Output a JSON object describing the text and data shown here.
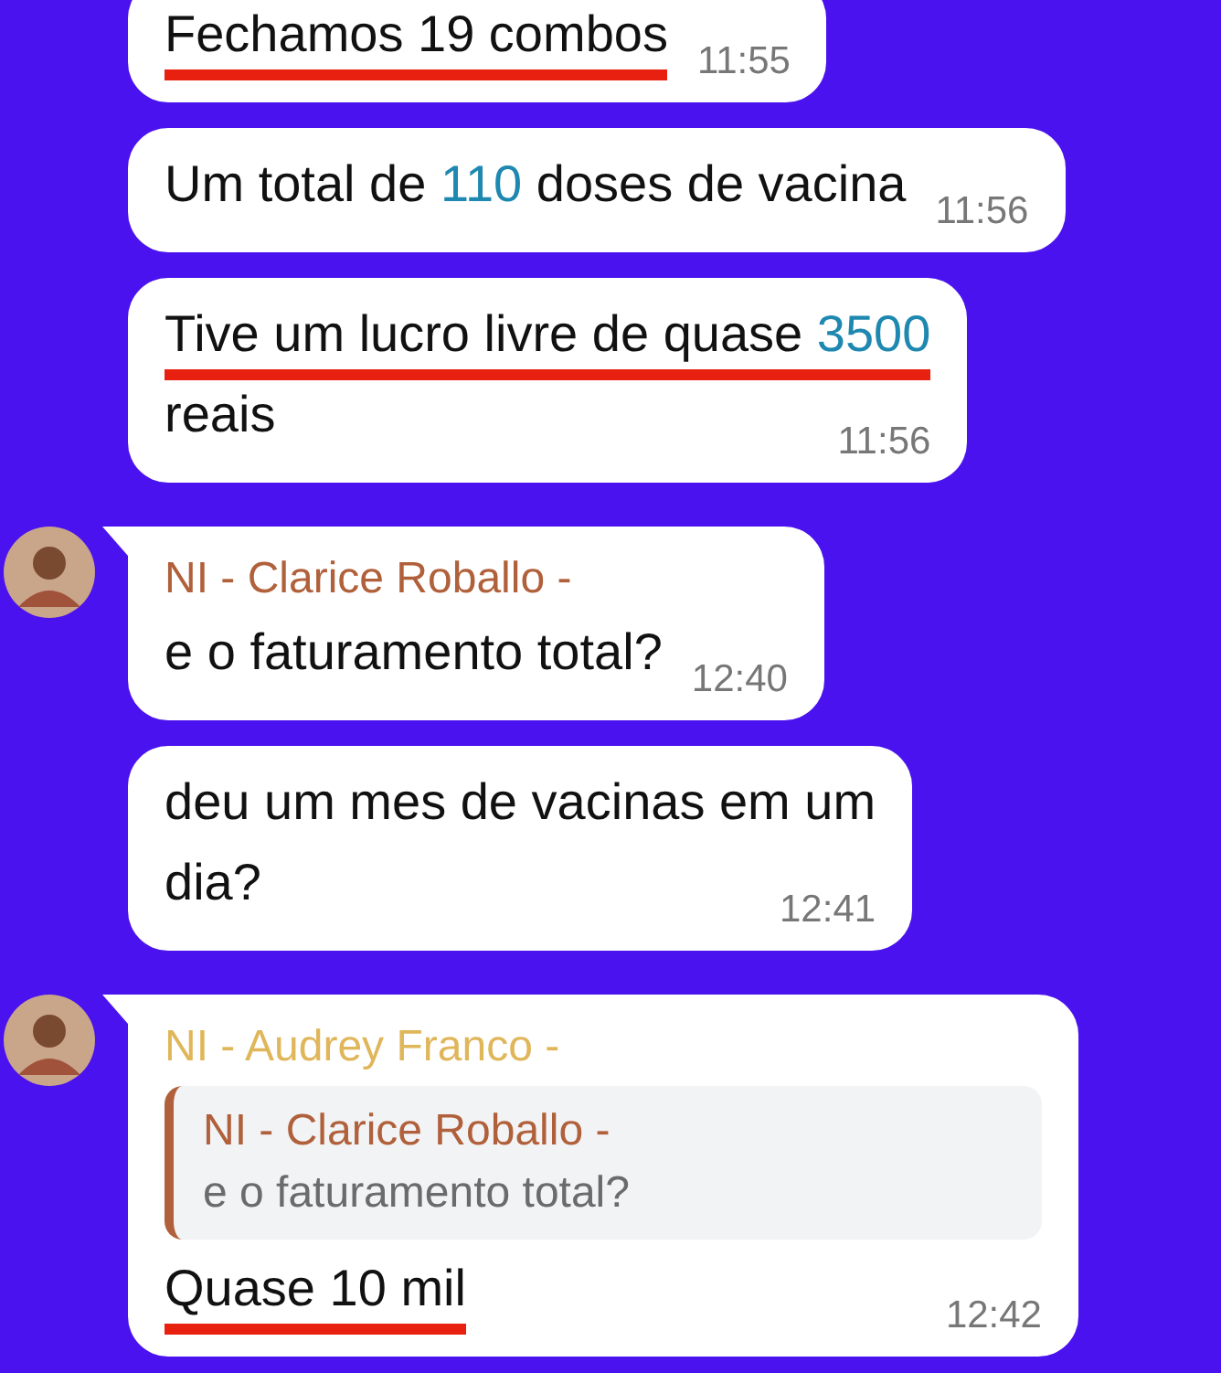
{
  "messages": [
    {
      "lines": [
        {
          "segments": [
            {
              "text": "Fechamos 19 combos",
              "kind": "plain"
            }
          ],
          "underlined": true
        }
      ],
      "time": "11:55"
    },
    {
      "lines": [
        {
          "segments": [
            {
              "text": "Um total de ",
              "kind": "plain"
            },
            {
              "text": "110",
              "kind": "number"
            },
            {
              "text": " doses de vacina",
              "kind": "plain"
            }
          ],
          "underlined": false
        }
      ],
      "time": "11:56"
    },
    {
      "lines": [
        {
          "segments": [
            {
              "text": "Tive um lucro livre de quase ",
              "kind": "plain"
            },
            {
              "text": "3500",
              "kind": "number"
            }
          ],
          "underlined": true
        },
        {
          "segments": [
            {
              "text": "reais",
              "kind": "plain"
            }
          ],
          "underlined": false
        }
      ],
      "time": "11:56"
    },
    {
      "sender": {
        "name": "NI - Clarice Roballo -",
        "color": "#b0603a"
      },
      "lines": [
        {
          "segments": [
            {
              "text": "e o faturamento total?",
              "kind": "plain"
            }
          ],
          "underlined": false
        }
      ],
      "time": "12:40"
    },
    {
      "lines": [
        {
          "segments": [
            {
              "text": "deu um mes de vacinas em um",
              "kind": "plain"
            }
          ],
          "underlined": false
        },
        {
          "segments": [
            {
              "text": "dia?",
              "kind": "plain"
            }
          ],
          "underlined": false
        }
      ],
      "time": "12:41"
    },
    {
      "sender": {
        "name": "NI - Audrey Franco -",
        "color": "#e0b65a"
      },
      "reply": {
        "name": "NI - Clarice Roballo -",
        "color": "#b0603a",
        "text": "e o faturamento total?"
      },
      "lines": [
        {
          "segments": [
            {
              "text": "Quase 10 mil",
              "kind": "plain"
            }
          ],
          "underlined": true
        }
      ],
      "time": "12:42"
    }
  ]
}
